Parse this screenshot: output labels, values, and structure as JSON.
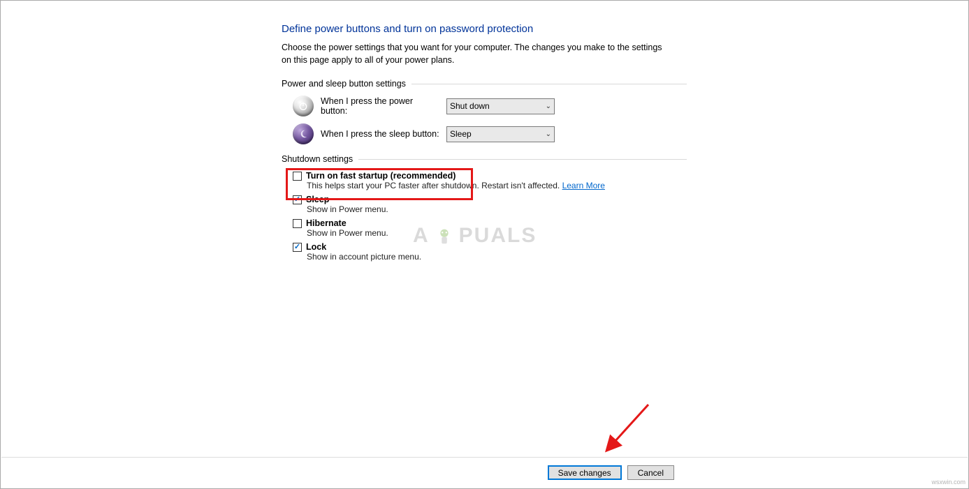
{
  "page": {
    "title": "Define power buttons and turn on password protection",
    "subtitle": "Choose the power settings that you want for your computer. The changes you make to the settings on this page apply to all of your power plans."
  },
  "sections": {
    "button_settings_title": "Power and sleep button settings",
    "shutdown_settings_title": "Shutdown settings"
  },
  "power_button": {
    "label": "When I press the power button:",
    "value": "Shut down"
  },
  "sleep_button": {
    "label": "When I press the sleep button:",
    "value": "Sleep"
  },
  "shutdown": {
    "fast_startup": {
      "label": "Turn on fast startup (recommended)",
      "desc_before": "This helps start your PC faster after shutdown.",
      "desc_after": " Restart isn't affected. ",
      "learn_more": "Learn More",
      "checked": false
    },
    "sleep": {
      "label": "Sleep",
      "desc": "Show in Power menu.",
      "checked": true
    },
    "hibernate": {
      "label": "Hibernate",
      "desc": "Show in Power menu.",
      "checked": false
    },
    "lock": {
      "label": "Lock",
      "desc": "Show in account picture menu.",
      "checked": true
    }
  },
  "buttons": {
    "save": "Save changes",
    "cancel": "Cancel"
  },
  "watermark": {
    "prefix": "A",
    "rest": "PUALS"
  },
  "credit": "wsxwin.com"
}
